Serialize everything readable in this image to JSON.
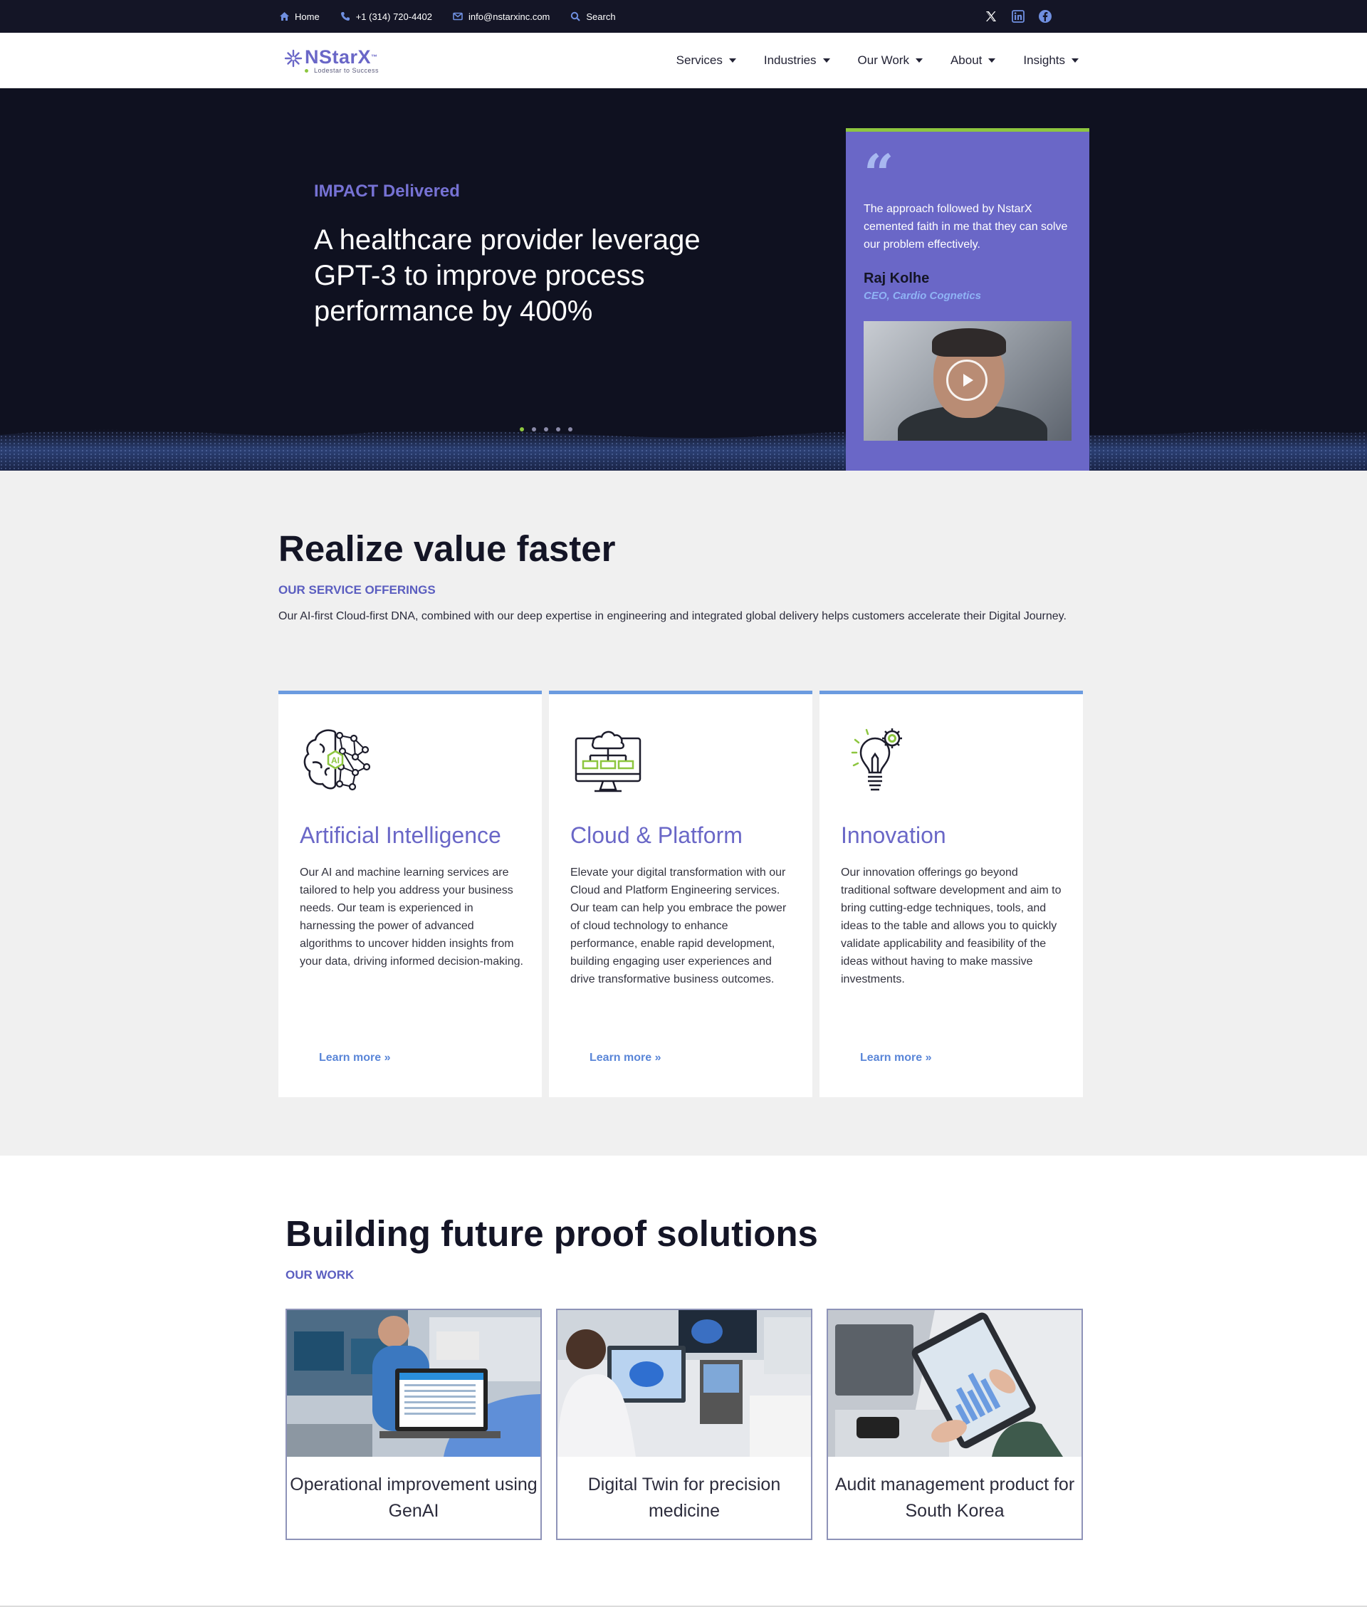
{
  "topbar": {
    "home": "Home",
    "phone": "+1 (314) 720-4402",
    "email": "info@nstarxinc.com",
    "search": "Search",
    "social": [
      "x-icon",
      "linkedin-icon",
      "facebook-icon"
    ]
  },
  "header": {
    "logo_brand": "NStarX",
    "logo_tm": "™",
    "logo_tagline": "Lodestar to Success",
    "nav": [
      "Services",
      "Industries",
      "Our Work",
      "About",
      "Insights"
    ]
  },
  "hero": {
    "kicker": "IMPACT Delivered",
    "headline": "A healthcare provider leverage GPT-3 to improve process performance by 400%",
    "slides_total": 5,
    "active_slide": 1,
    "quote": {
      "text": "The approach followed by NstarX cemented faith in me that they can solve our problem effectively.",
      "name": "Raj Kolhe",
      "role": "CEO, Cardio Cognetics"
    }
  },
  "services": {
    "title": "Realize value faster",
    "kicker": "OUR SERVICE OFFERINGS",
    "description": "Our AI-first Cloud-first DNA, combined with our deep expertise in engineering and integrated global delivery helps customers accelerate their Digital Journey.",
    "cards": [
      {
        "title": "Artificial Intelligence",
        "icon": "ai-brain-icon",
        "text": "Our AI and machine learning services are tailored to help you address your business needs. Our team is experienced in  harnessing the power of advanced algorithms to uncover hidden insights from your data, driving informed decision-making.",
        "link": "Learn more »"
      },
      {
        "title": "Cloud & Platform",
        "icon": "cloud-monitor-icon",
        "text": "Elevate your digital transformation with our Cloud and Platform Engineering services. Our team can help you embrace the power of cloud technology to enhance performance, enable rapid development, building engaging user experiences and drive transformative business outcomes.",
        "link": "Learn more »"
      },
      {
        "title": "Innovation",
        "icon": "lightbulb-gear-icon",
        "text": "Our innovation offerings go beyond traditional software development and aim to bring cutting-edge techniques, tools, and ideas to the table and allows you to quickly validate applicability and feasibility of the ideas without having to make massive investments.",
        "link": "Learn more »"
      }
    ]
  },
  "work": {
    "title": "Building future proof solutions",
    "kicker": "OUR WORK",
    "cards": [
      {
        "title": "Operational improvement using GenAI"
      },
      {
        "title": "Digital Twin for precision medicine"
      },
      {
        "title": "Audit management product for South Korea"
      }
    ]
  },
  "colors": {
    "navy": "#141526",
    "brand_purple": "#6a67c7",
    "accent_green": "#8dc63f",
    "link_blue": "#5a86d8"
  }
}
